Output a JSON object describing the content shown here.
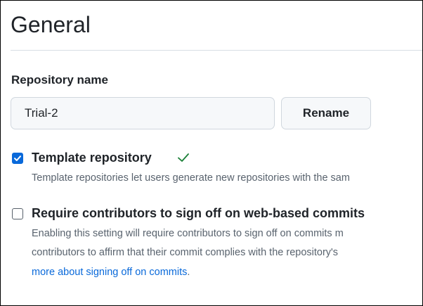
{
  "section": {
    "title": "General"
  },
  "repository_name": {
    "label": "Repository name",
    "value": "Trial-2",
    "rename_label": "Rename"
  },
  "template_repository": {
    "checked": true,
    "label": "Template repository",
    "status_icon": "check-icon",
    "status_color": "#1a7f37",
    "description": "Template repositories let users generate new repositories with the sam"
  },
  "sign_off": {
    "checked": false,
    "label": "Require contributors to sign off on web-based commits",
    "description_line1": "Enabling this setting will require contributors to sign off on commits m",
    "description_line2": "contributors to affirm that their commit complies with the repository's",
    "link_text": "more about signing off on commits",
    "after_link": "."
  },
  "colors": {
    "accent": "#0969da",
    "text": "#1f2328",
    "muted": "#59636e",
    "border": "#d0d7de",
    "input_bg": "#f6f8fa"
  }
}
